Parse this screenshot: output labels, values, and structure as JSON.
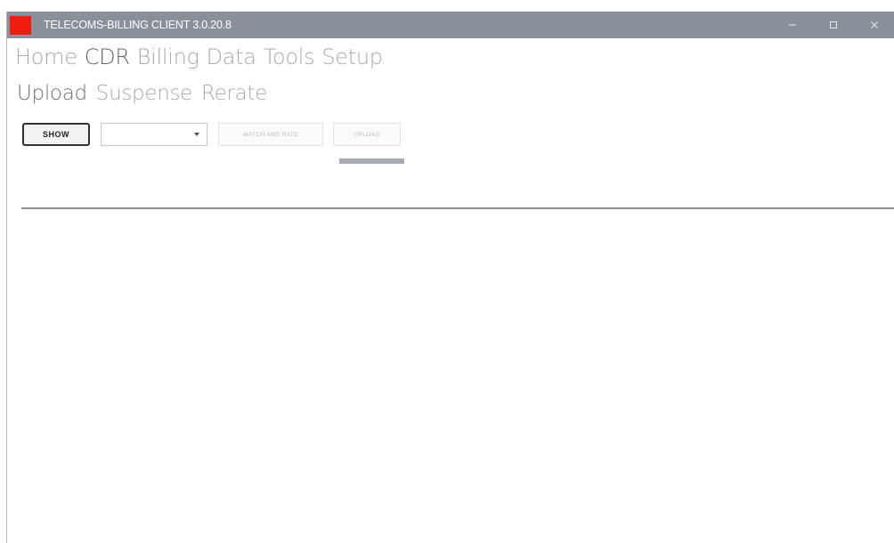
{
  "window": {
    "title": "TELECOMS-BILLING CLIENT 3.0.20.8",
    "accent_color": "#ef1c10",
    "titlebar_color": "#8a9099",
    "controls": [
      "minimize-icon",
      "maximize-icon",
      "close-icon"
    ]
  },
  "menu": {
    "items": [
      {
        "label": "Home",
        "active": false
      },
      {
        "label": "CDR",
        "active": true
      },
      {
        "label": "Billing",
        "active": false
      },
      {
        "label": "Data",
        "active": false
      },
      {
        "label": "Tools",
        "active": false
      },
      {
        "label": "Setup",
        "active": false
      }
    ]
  },
  "submenu": {
    "items": [
      {
        "label": "Upload",
        "active": true
      },
      {
        "label": "Suspense",
        "active": false
      },
      {
        "label": "Rerate",
        "active": false
      }
    ]
  },
  "toolbar": {
    "show_label": "SHOW",
    "combo_value": "",
    "match_label": "MATCH AND RATE",
    "upload_label": "UPLOAD",
    "progress": 1.0
  }
}
